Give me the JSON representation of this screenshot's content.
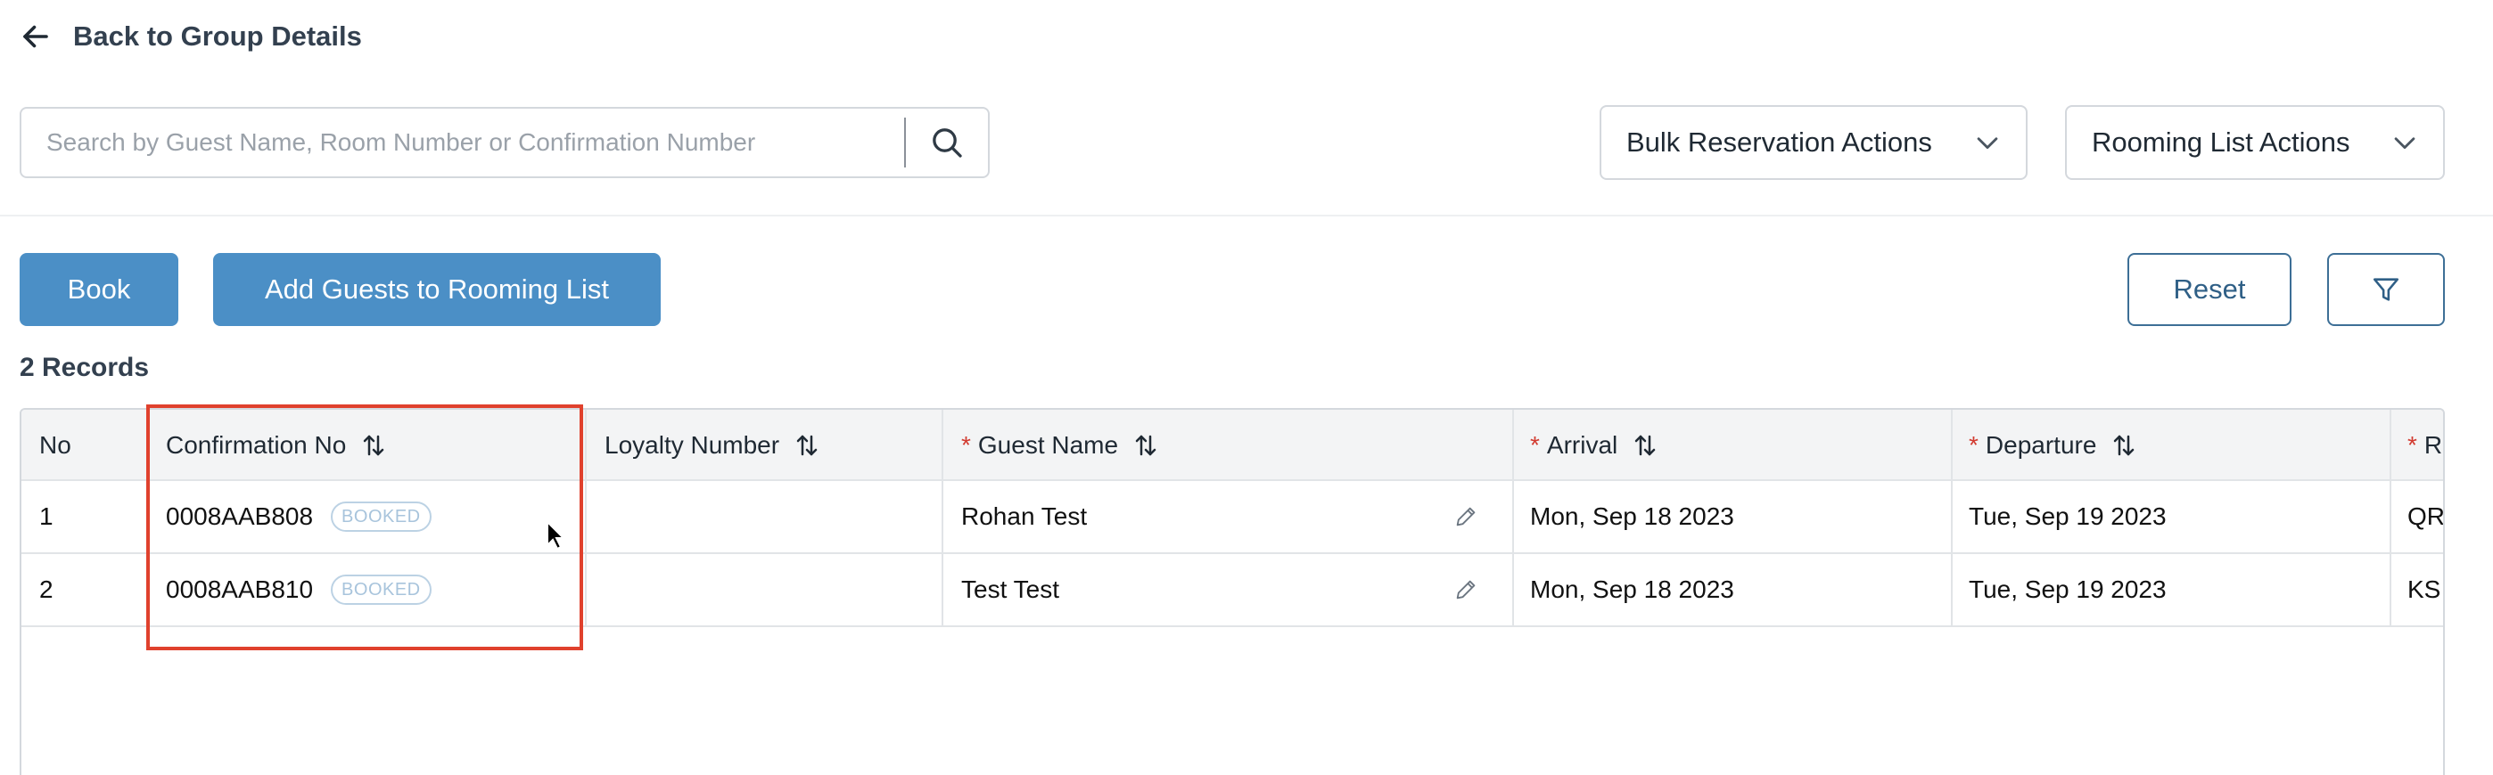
{
  "nav": {
    "back_label": "Back to Group Details",
    "icon": "arrow-left-icon"
  },
  "search": {
    "placeholder": "Search by Guest Name, Room Number or Confirmation Number",
    "value": "",
    "icon": "search-icon"
  },
  "dropdowns": {
    "bulk_label": "Bulk Reservation Actions",
    "rooming_label": "Rooming List Actions",
    "icon": "chevron-down-icon"
  },
  "actions": {
    "book_label": "Book",
    "add_guests_label": "Add Guests to Rooming List",
    "reset_label": "Reset",
    "filter_icon": "filter-icon"
  },
  "records_label": "2 Records",
  "table": {
    "columns": [
      {
        "label": "No",
        "required": false,
        "sortable": false
      },
      {
        "label": "Confirmation No",
        "required": false,
        "sortable": true
      },
      {
        "label": "Loyalty Number",
        "required": false,
        "sortable": true
      },
      {
        "label": "Guest Name",
        "required": true,
        "sortable": true
      },
      {
        "label": "Arrival",
        "required": true,
        "sortable": true
      },
      {
        "label": "Departure",
        "required": true,
        "sortable": true
      },
      {
        "label": "Ro",
        "required": true,
        "sortable": false
      }
    ],
    "required_mark": "*",
    "rows": [
      {
        "no": "1",
        "confirmation": "0008AAB808",
        "status": "BOOKED",
        "loyalty": "",
        "guest": "Rohan Test",
        "arrival": "Mon, Sep 18 2023",
        "departure": "Tue, Sep 19 2023",
        "room": "QR"
      },
      {
        "no": "2",
        "confirmation": "0008AAB810",
        "status": "BOOKED",
        "loyalty": "",
        "guest": "Test Test",
        "arrival": "Mon, Sep 18 2023",
        "departure": "Tue, Sep 19 2023",
        "room": "KS"
      }
    ]
  },
  "colors": {
    "primary": "#4b8fc6",
    "outline": "#3d6f96",
    "highlight": "#e0412d",
    "required": "#d23b30",
    "badge": "#a8c4dc"
  }
}
